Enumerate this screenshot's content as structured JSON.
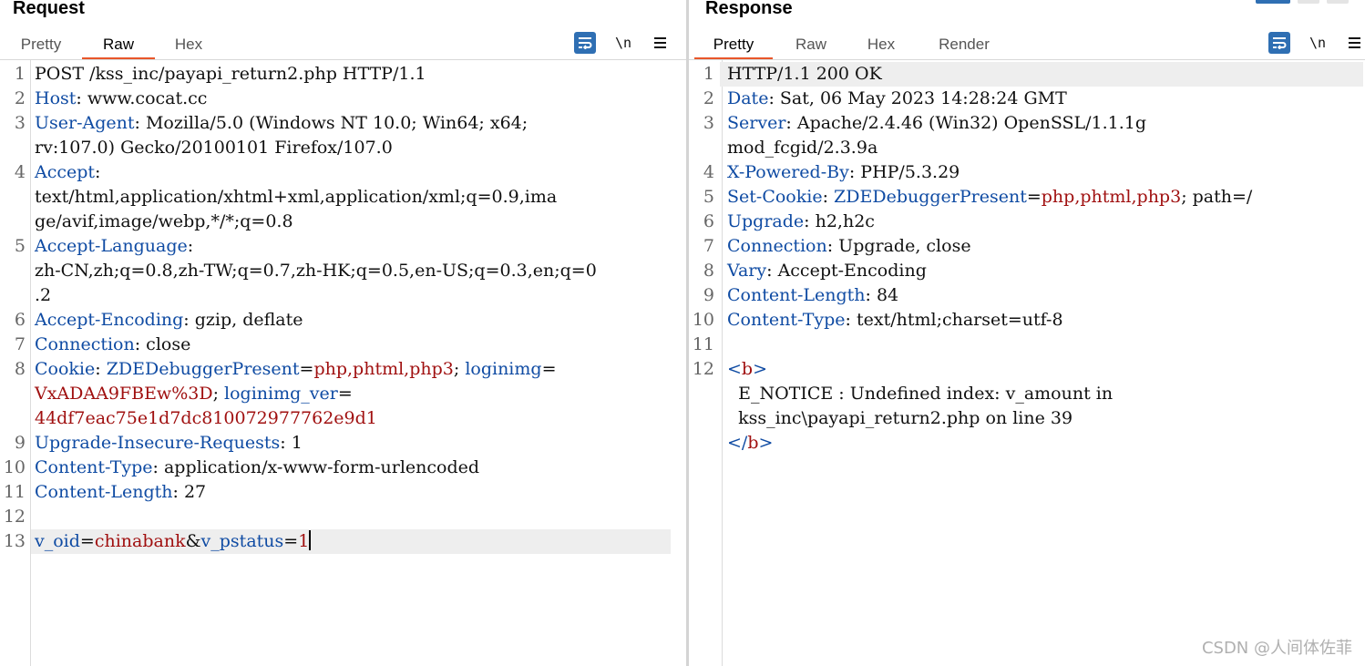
{
  "request": {
    "title": "Request",
    "tabs": [
      "Pretty",
      "Raw",
      "Hex"
    ],
    "active_tab": "Raw",
    "newline_label": "\\n",
    "lines": [
      {
        "n": "1",
        "parts": [
          [
            "v",
            "POST /kss_inc/payapi_return2.php HTTP/1.1"
          ]
        ]
      },
      {
        "n": "2",
        "parts": [
          [
            "k",
            "Host"
          ],
          [
            "v",
            ": www.cocat.cc"
          ]
        ]
      },
      {
        "n": "3",
        "parts": [
          [
            "k",
            "User-Agent"
          ],
          [
            "v",
            ": Mozilla/5.0 (Windows NT 10.0; Win64; x64;"
          ]
        ]
      },
      {
        "n": "",
        "parts": [
          [
            "v",
            "rv:107.0) Gecko/20100101 Firefox/107.0"
          ]
        ]
      },
      {
        "n": "4",
        "parts": [
          [
            "k",
            "Accept"
          ],
          [
            "v",
            ":"
          ]
        ]
      },
      {
        "n": "",
        "parts": [
          [
            "v",
            "text/html,application/xhtml+xml,application/xml;q=0.9,ima"
          ]
        ]
      },
      {
        "n": "",
        "parts": [
          [
            "v",
            "ge/avif,image/webp,*/*;q=0.8"
          ]
        ]
      },
      {
        "n": "5",
        "parts": [
          [
            "k",
            "Accept-Language"
          ],
          [
            "v",
            ":"
          ]
        ]
      },
      {
        "n": "",
        "parts": [
          [
            "v",
            "zh-CN,zh;q=0.8,zh-TW;q=0.7,zh-HK;q=0.5,en-US;q=0.3,en;q=0"
          ]
        ]
      },
      {
        "n": "",
        "parts": [
          [
            "v",
            ".2"
          ]
        ]
      },
      {
        "n": "6",
        "parts": [
          [
            "k",
            "Accept-Encoding"
          ],
          [
            "v",
            ": gzip, deflate"
          ]
        ]
      },
      {
        "n": "7",
        "parts": [
          [
            "k",
            "Connection"
          ],
          [
            "v",
            ": close"
          ]
        ]
      },
      {
        "n": "8",
        "parts": [
          [
            "k",
            "Cookie"
          ],
          [
            "v",
            ": "
          ],
          [
            "k",
            "ZDEDebuggerPresent"
          ],
          [
            "v",
            "="
          ],
          [
            "r",
            "php,phtml,php3"
          ],
          [
            "v",
            "; "
          ],
          [
            "k",
            "loginimg"
          ],
          [
            "v",
            "="
          ]
        ]
      },
      {
        "n": "",
        "parts": [
          [
            "r",
            "VxADAA9FBEw%3D"
          ],
          [
            "v",
            "; "
          ],
          [
            "k",
            "loginimg_ver"
          ],
          [
            "v",
            "="
          ]
        ]
      },
      {
        "n": "",
        "parts": [
          [
            "r",
            "44df7eac75e1d7dc810072977762e9d1"
          ]
        ]
      },
      {
        "n": "9",
        "parts": [
          [
            "k",
            "Upgrade-Insecure-Requests"
          ],
          [
            "v",
            ": 1"
          ]
        ]
      },
      {
        "n": "10",
        "parts": [
          [
            "k",
            "Content-Type"
          ],
          [
            "v",
            ": application/x-www-form-urlencoded"
          ]
        ]
      },
      {
        "n": "11",
        "parts": [
          [
            "k",
            "Content-Length"
          ],
          [
            "v",
            ": 27"
          ]
        ]
      },
      {
        "n": "12",
        "parts": []
      },
      {
        "n": "13",
        "hl": true,
        "cursor": true,
        "parts": [
          [
            "k",
            "v_oid"
          ],
          [
            "v",
            "="
          ],
          [
            "r",
            "chinabank"
          ],
          [
            "v",
            "&"
          ],
          [
            "k",
            "v_pstatus"
          ],
          [
            "v",
            "="
          ],
          [
            "r",
            "1"
          ]
        ]
      }
    ]
  },
  "response": {
    "title": "Response",
    "tabs": [
      "Pretty",
      "Raw",
      "Hex",
      "Render"
    ],
    "active_tab": "Pretty",
    "newline_label": "\\n",
    "lines": [
      {
        "n": "1",
        "hl": true,
        "parts": [
          [
            "v",
            "HTTP/1.1 200 OK"
          ]
        ]
      },
      {
        "n": "2",
        "parts": [
          [
            "k",
            "Date"
          ],
          [
            "v",
            ": Sat, 06 May 2023 14:28:24 GMT"
          ]
        ]
      },
      {
        "n": "3",
        "parts": [
          [
            "k",
            "Server"
          ],
          [
            "v",
            ": Apache/2.4.46 (Win32) OpenSSL/1.1.1g"
          ]
        ]
      },
      {
        "n": "",
        "parts": [
          [
            "v",
            "mod_fcgid/2.3.9a"
          ]
        ]
      },
      {
        "n": "4",
        "parts": [
          [
            "k",
            "X-Powered-By"
          ],
          [
            "v",
            ": PHP/5.3.29"
          ]
        ]
      },
      {
        "n": "5",
        "parts": [
          [
            "k",
            "Set-Cookie"
          ],
          [
            "v",
            ": "
          ],
          [
            "k",
            "ZDEDebuggerPresent"
          ],
          [
            "v",
            "="
          ],
          [
            "r",
            "php,phtml,php3"
          ],
          [
            "v",
            "; path=/"
          ]
        ]
      },
      {
        "n": "6",
        "parts": [
          [
            "k",
            "Upgrade"
          ],
          [
            "v",
            ": h2,h2c"
          ]
        ]
      },
      {
        "n": "7",
        "parts": [
          [
            "k",
            "Connection"
          ],
          [
            "v",
            ": Upgrade, close"
          ]
        ]
      },
      {
        "n": "8",
        "parts": [
          [
            "k",
            "Vary"
          ],
          [
            "v",
            ": Accept-Encoding"
          ]
        ]
      },
      {
        "n": "9",
        "parts": [
          [
            "k",
            "Content-Length"
          ],
          [
            "v",
            ": 84"
          ]
        ]
      },
      {
        "n": "10",
        "parts": [
          [
            "k",
            "Content-Type"
          ],
          [
            "v",
            ": text/html;charset=utf-8"
          ]
        ]
      },
      {
        "n": "11",
        "parts": []
      },
      {
        "n": "12",
        "parts": [
          [
            "k",
            "<"
          ],
          [
            "r",
            "b"
          ],
          [
            "k",
            ">"
          ]
        ]
      },
      {
        "n": "",
        "parts": [
          [
            "v",
            "  E_NOTICE : Undefined index: v_amount in"
          ]
        ]
      },
      {
        "n": "",
        "parts": [
          [
            "v",
            "  kss_inc\\payapi_return2.php on line 39"
          ]
        ]
      },
      {
        "n": "",
        "parts": [
          [
            "k",
            "</"
          ],
          [
            "r",
            "b"
          ],
          [
            "k",
            ">"
          ]
        ]
      }
    ]
  },
  "watermark": "CSDN @人间体佐菲",
  "colors": {
    "key": "#0f4ba3",
    "value_red": "#a01010",
    "accent_tab": "#e8562a",
    "wrap_btn": "#2f6fb3"
  }
}
